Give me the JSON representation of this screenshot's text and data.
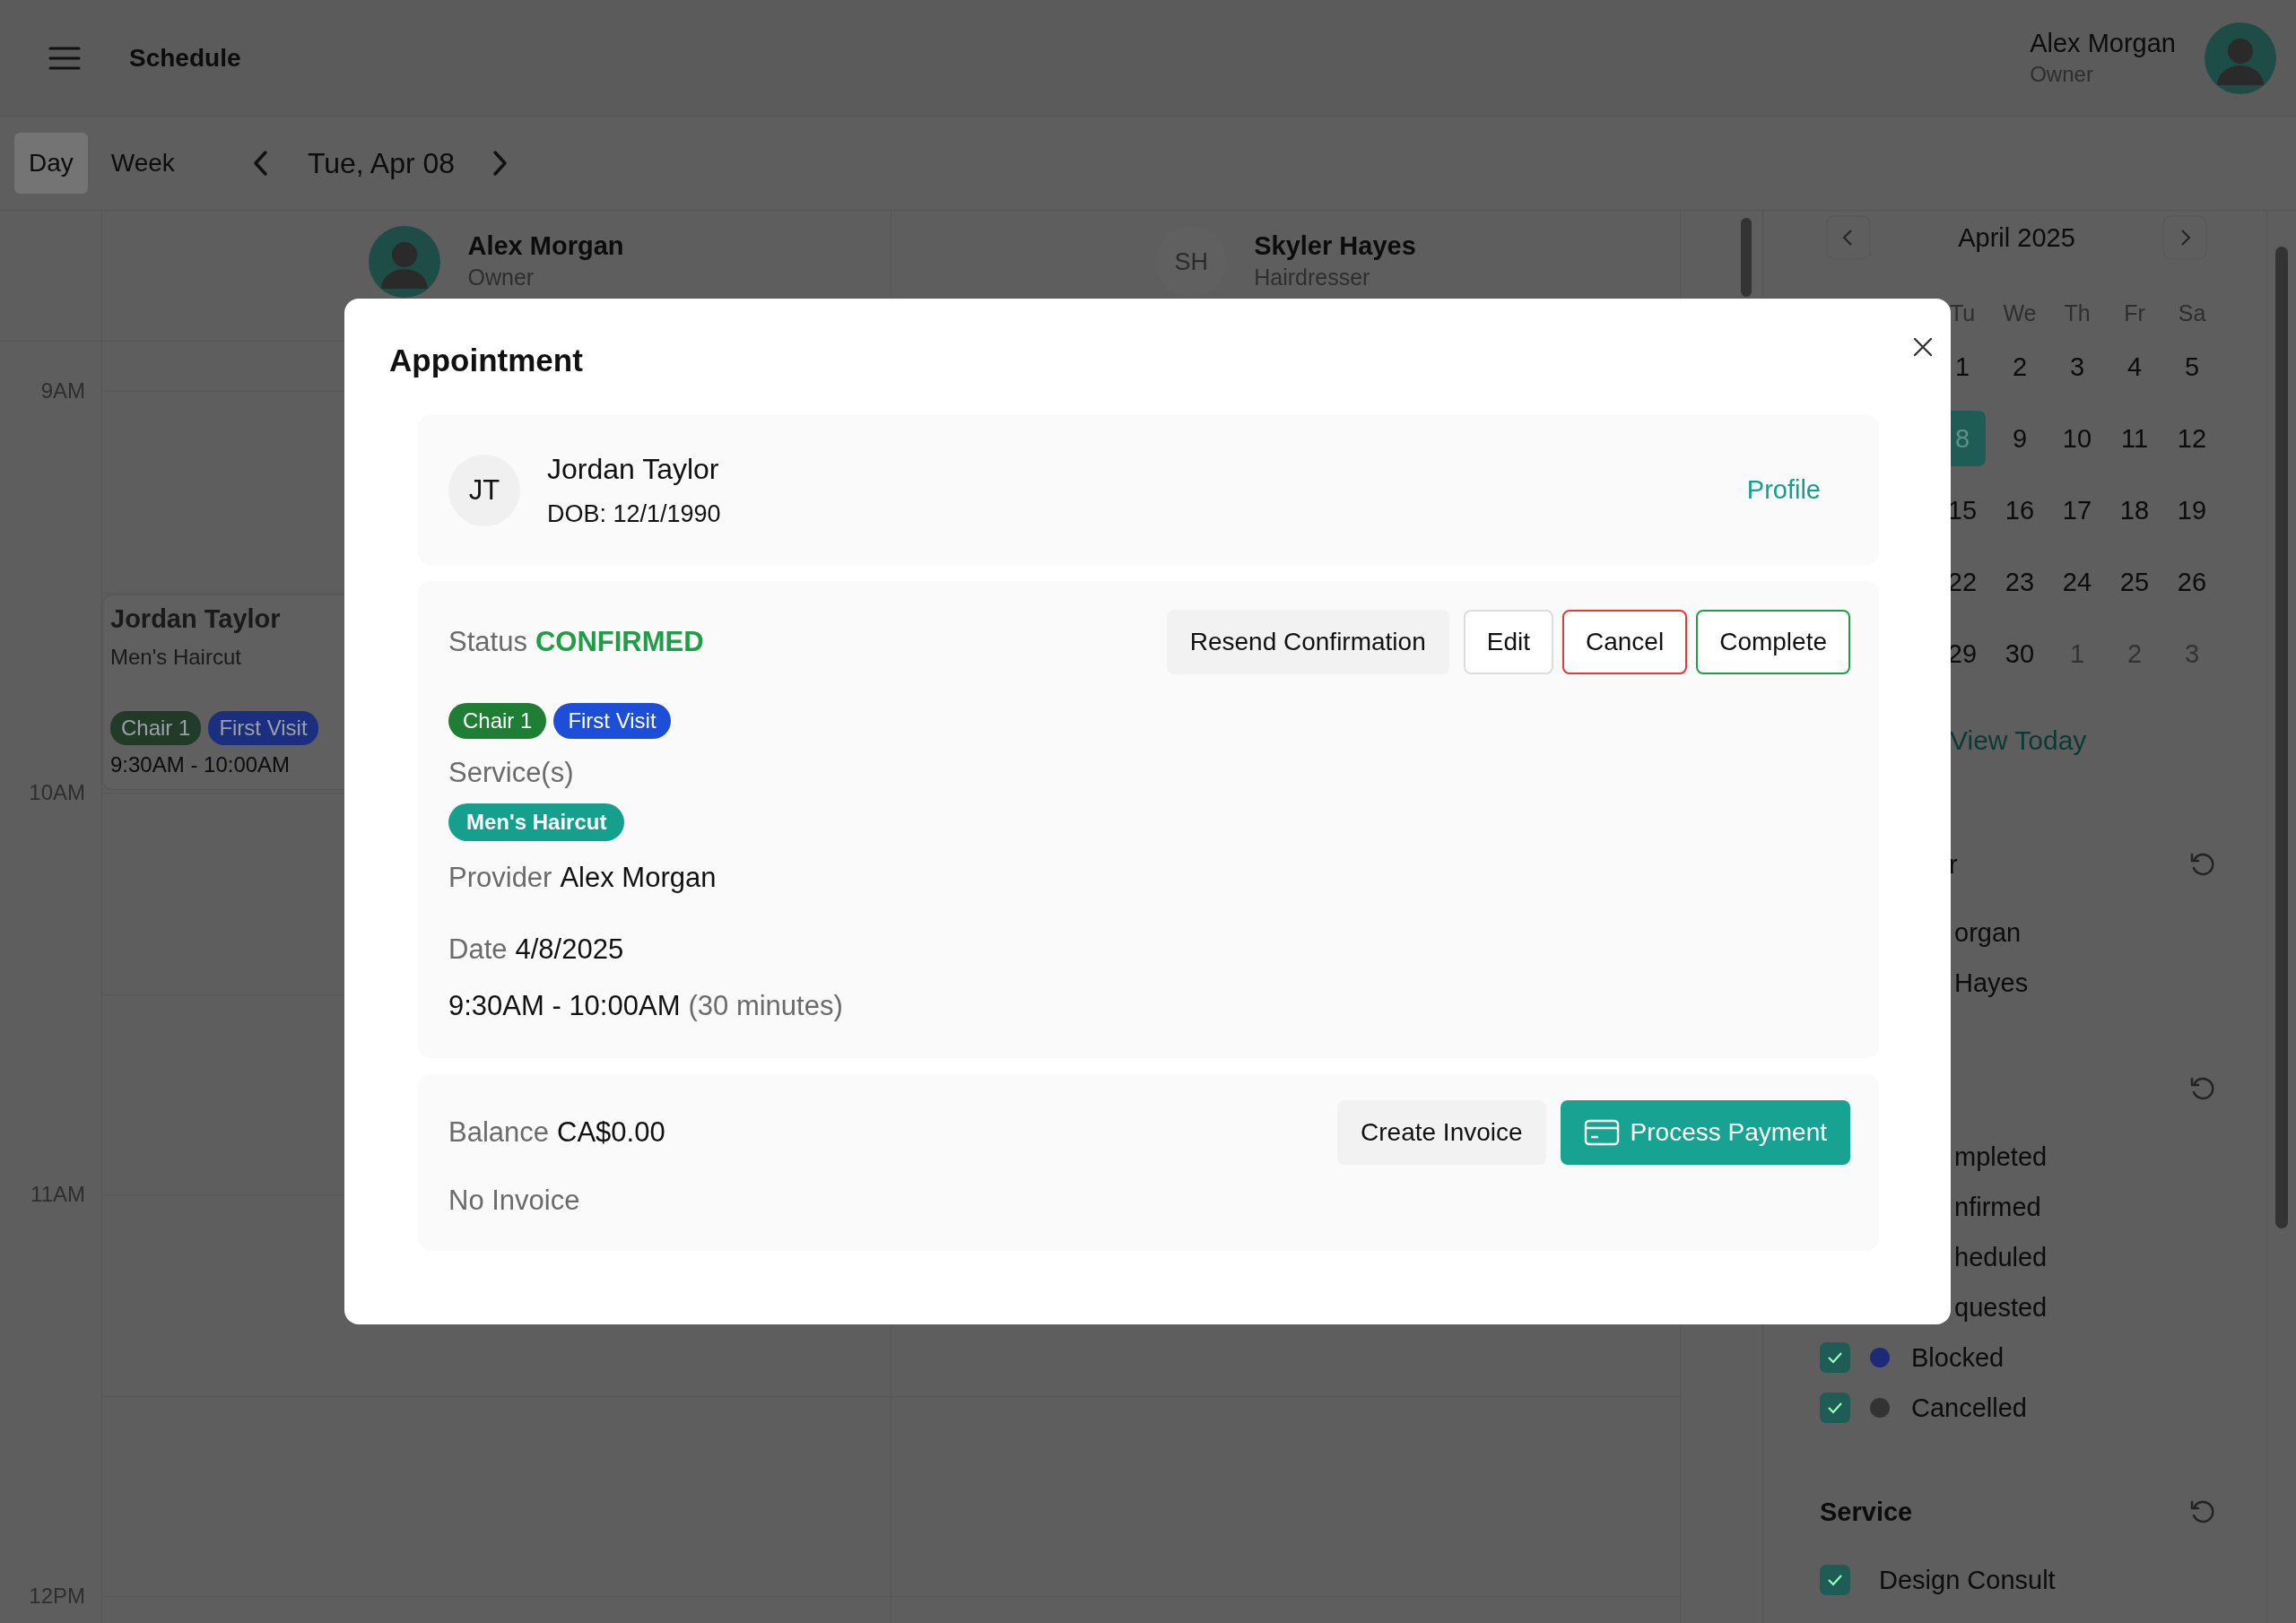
{
  "header": {
    "title": "Schedule",
    "user": {
      "name": "Alex Morgan",
      "role": "Owner"
    }
  },
  "toolbar": {
    "views": [
      {
        "label": "Day",
        "selected": true
      },
      {
        "label": "Week",
        "selected": false
      }
    ],
    "date": "Tue, Apr 08"
  },
  "schedule": {
    "providers": [
      {
        "kind": "picture",
        "name": "Alex Morgan",
        "role": "Owner"
      },
      {
        "kind": "initials",
        "initials": "SH",
        "name": "Skyler Hayes",
        "role": "Hairdresser"
      }
    ],
    "hours": [
      "9AM",
      "10AM",
      "11AM",
      "12PM"
    ],
    "event": {
      "client": "Jordan Taylor",
      "service": "Men's Haircut",
      "tags": [
        {
          "label": "Chair 1",
          "color": "#223a28"
        },
        {
          "label": "First Visit",
          "color": "#1c2f7e"
        }
      ],
      "time": "9:30AM - 10:00AM"
    }
  },
  "sidebar": {
    "calendar": {
      "month": "April 2025",
      "weekdays": [
        "Tu",
        "We",
        "Th",
        "Fr",
        "Sa"
      ],
      "weeks": [
        [
          {
            "day": "1",
            "selected": false,
            "muted": false
          },
          {
            "day": "2",
            "selected": false,
            "muted": false
          },
          {
            "day": "3",
            "selected": false,
            "muted": false
          },
          {
            "day": "4",
            "selected": false,
            "muted": false
          },
          {
            "day": "5",
            "selected": false,
            "muted": false
          }
        ],
        [
          {
            "day": "8",
            "selected": true,
            "muted": false
          },
          {
            "day": "9",
            "selected": false,
            "muted": false
          },
          {
            "day": "10",
            "selected": false,
            "muted": false
          },
          {
            "day": "11",
            "selected": false,
            "muted": false
          },
          {
            "day": "12",
            "selected": false,
            "muted": false
          }
        ],
        [
          {
            "day": "15",
            "selected": false,
            "muted": false
          },
          {
            "day": "16",
            "selected": false,
            "muted": false
          },
          {
            "day": "17",
            "selected": false,
            "muted": false
          },
          {
            "day": "18",
            "selected": false,
            "muted": false
          },
          {
            "day": "19",
            "selected": false,
            "muted": false
          }
        ],
        [
          {
            "day": "22",
            "selected": false,
            "muted": false
          },
          {
            "day": "23",
            "selected": false,
            "muted": false
          },
          {
            "day": "24",
            "selected": false,
            "muted": false
          },
          {
            "day": "25",
            "selected": false,
            "muted": false
          },
          {
            "day": "26",
            "selected": false,
            "muted": false
          }
        ],
        [
          {
            "day": "29",
            "selected": false,
            "muted": false
          },
          {
            "day": "30",
            "selected": false,
            "muted": false
          },
          {
            "day": "1",
            "selected": false,
            "muted": true
          },
          {
            "day": "2",
            "selected": false,
            "muted": true
          },
          {
            "day": "3",
            "selected": false,
            "muted": true
          }
        ]
      ]
    },
    "view_today": "View Today",
    "filters": [
      {
        "title": "r",
        "items": [
          {
            "kind": "clipped",
            "label": "organ"
          },
          {
            "kind": "clipped",
            "label": "Hayes"
          }
        ]
      },
      {
        "items": [
          {
            "kind": "clipped",
            "label": "mpleted"
          },
          {
            "kind": "clipped",
            "label": "nfirmed"
          },
          {
            "kind": "clipped",
            "label": "heduled"
          },
          {
            "kind": "clipped",
            "label": "quested"
          },
          {
            "kind": "check",
            "label": "Blocked",
            "checked": true,
            "color": "#1c2a78"
          },
          {
            "kind": "check",
            "label": "Cancelled",
            "checked": true,
            "color": "#333333"
          }
        ]
      },
      {
        "title": "Service",
        "items": [
          {
            "kind": "check",
            "label": "Design Consult",
            "checked": true
          }
        ]
      }
    ]
  },
  "modal": {
    "title": "Appointment",
    "client": {
      "initials": "JT",
      "name": "Jordan Taylor",
      "dob": "DOB: 12/1/1990",
      "link": "Profile"
    },
    "status": {
      "label": "Status",
      "value": "CONFIRMED"
    },
    "actions": [
      {
        "label": "Resend Confirmation",
        "kind": "soft"
      },
      {
        "label": "Edit",
        "kind": "plain"
      },
      {
        "label": "Cancel",
        "kind": "danger"
      },
      {
        "label": "Complete",
        "kind": "success"
      }
    ],
    "tags": [
      {
        "label": "Chair 1",
        "color": "#1e7e34"
      },
      {
        "label": "First Visit",
        "color": "#1d4ed8"
      }
    ],
    "services_label": "Service(s)",
    "services": [
      {
        "label": "Men's Haircut",
        "color": "#14a08c"
      }
    ],
    "provider": {
      "label": "Provider",
      "value": "Alex Morgan"
    },
    "date": {
      "label": "Date",
      "value": "4/8/2025"
    },
    "time": {
      "value": "9:30AM - 10:00AM",
      "duration": "(30 minutes)"
    },
    "balance": {
      "label": "Balance",
      "value": "CA$0.00"
    },
    "invoice": "No Invoice",
    "billing_actions": [
      {
        "label": "Create Invoice",
        "kind": "soft"
      },
      {
        "label": "Process Payment",
        "kind": "primary"
      }
    ]
  }
}
